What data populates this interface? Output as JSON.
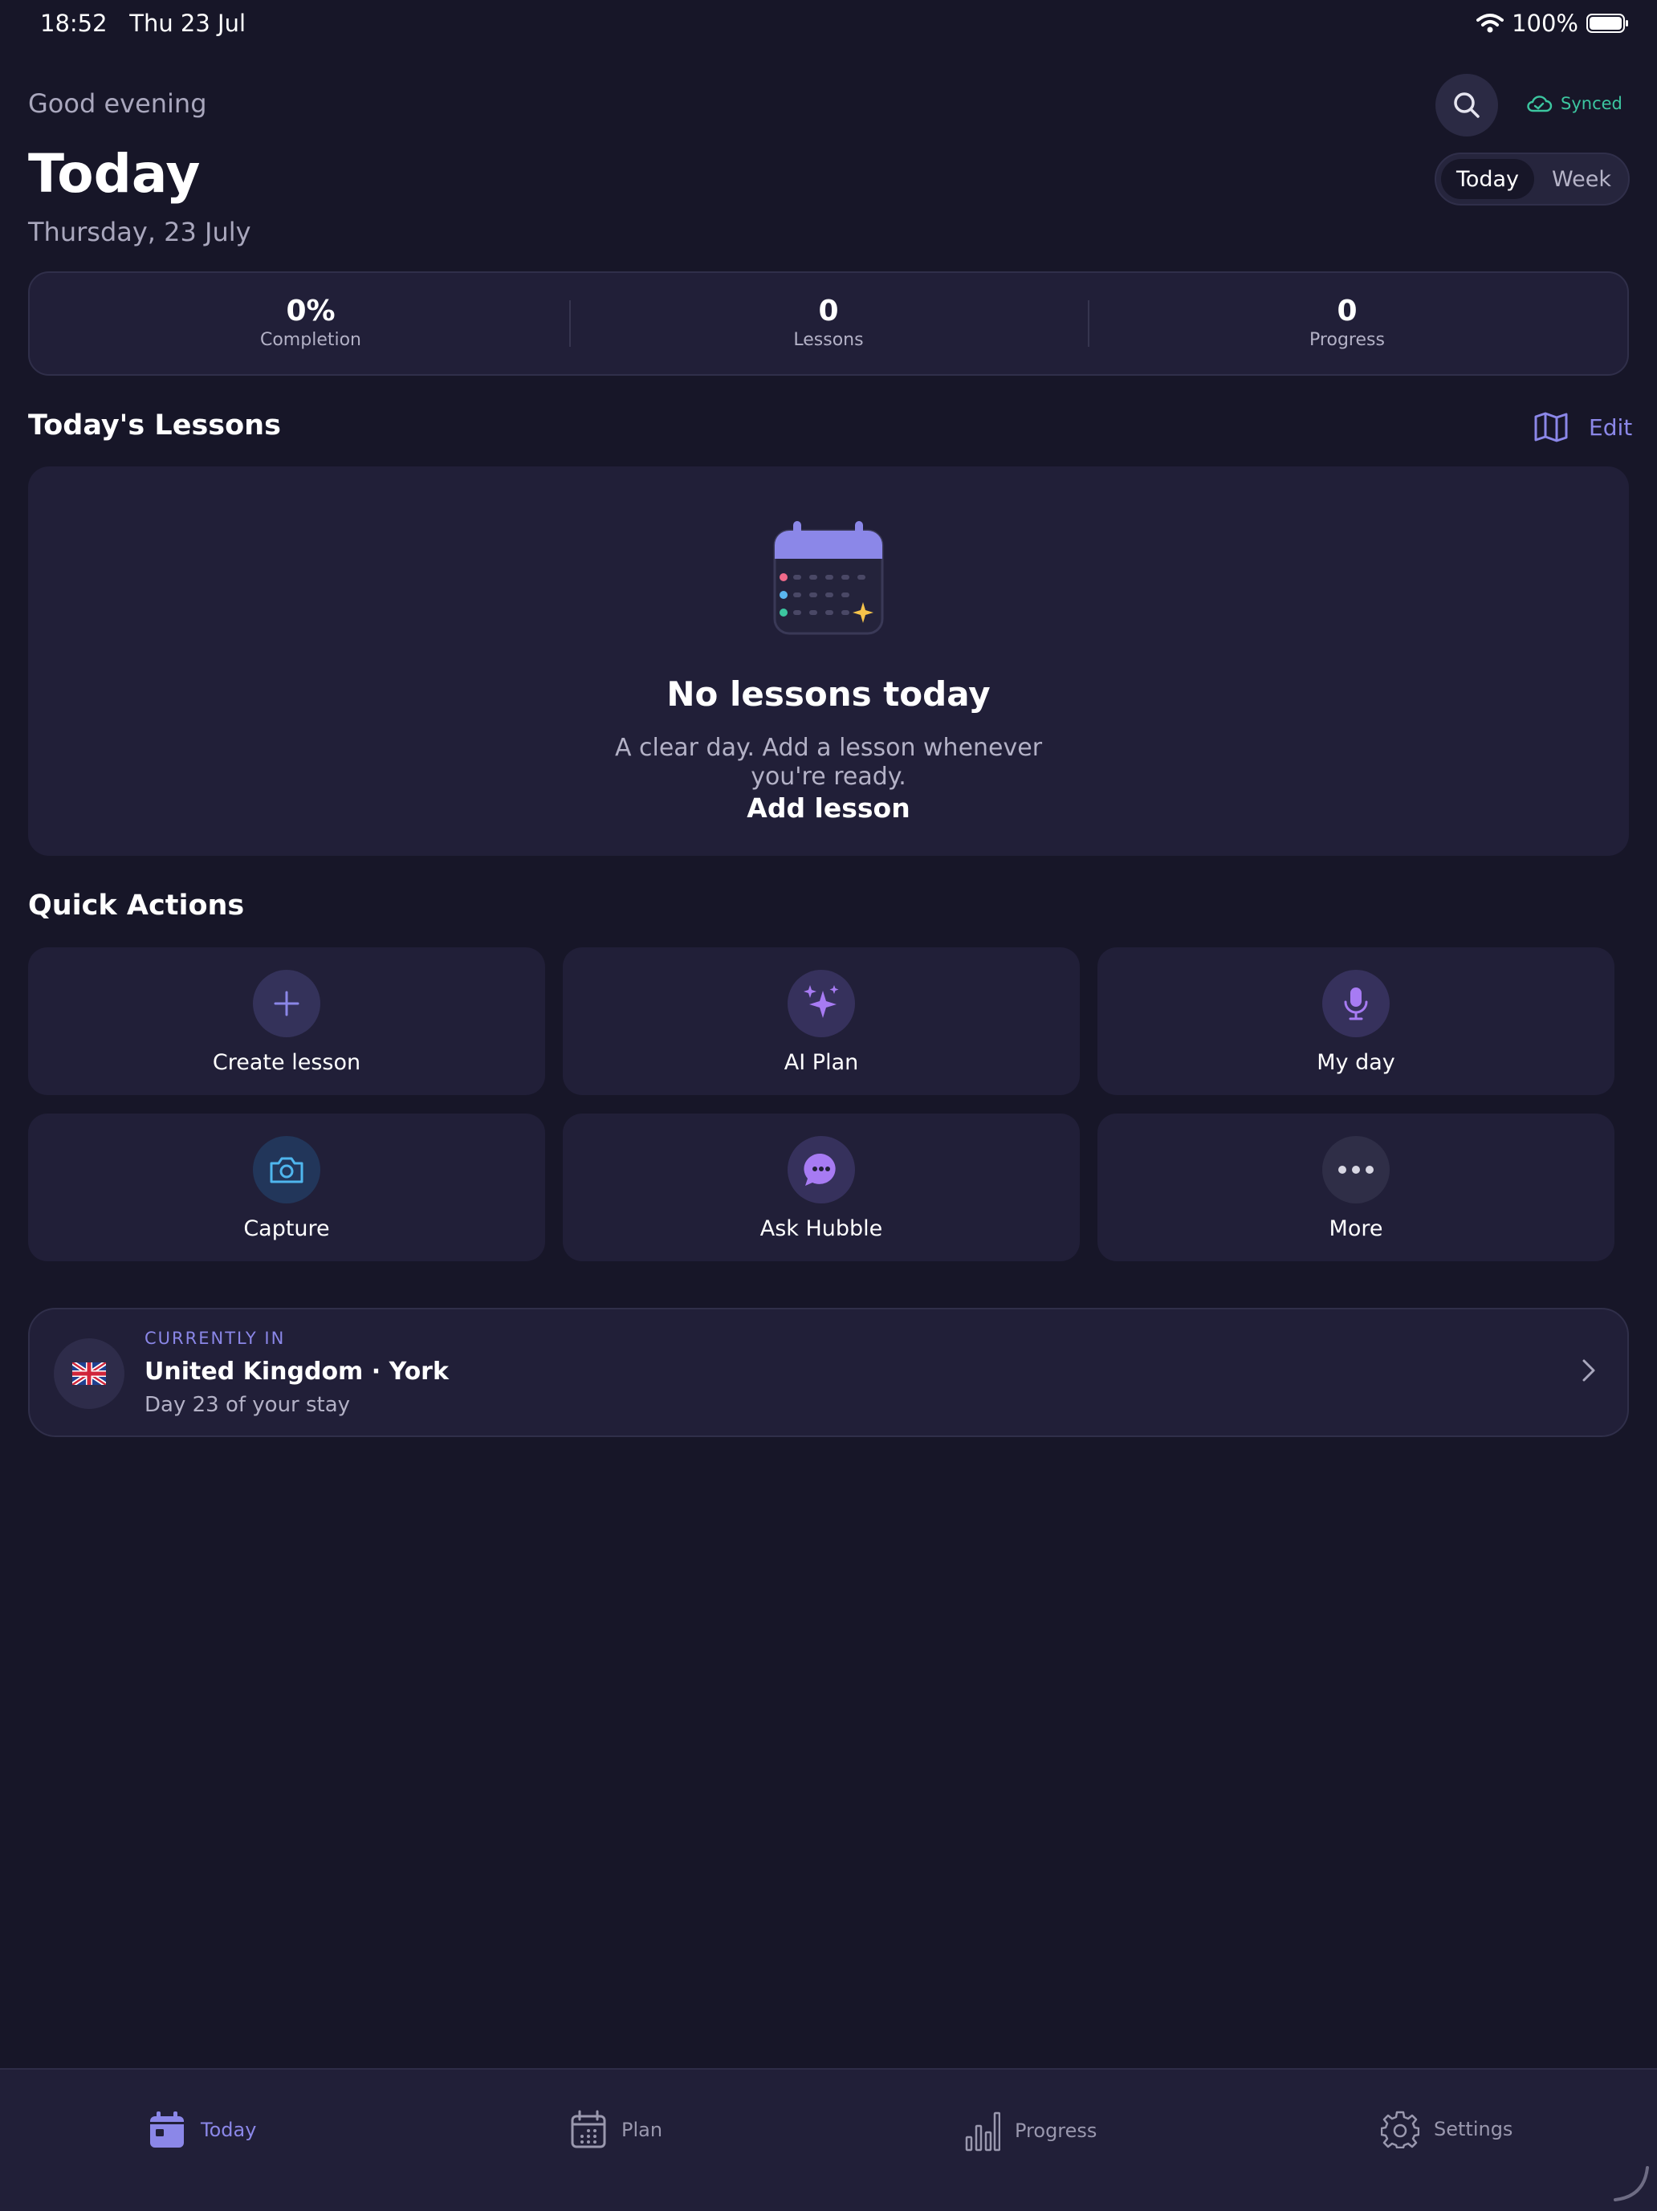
{
  "status_bar": {
    "time": "18:52",
    "date": "Thu 23 Jul",
    "battery": "100%"
  },
  "header": {
    "greeting": "Good evening",
    "title": "Today",
    "date": "Thursday, 23 July",
    "sync_status": "Synced",
    "segments": [
      "Today",
      "Week"
    ],
    "selected_segment": "Today"
  },
  "stats": [
    {
      "value": "0%",
      "label": "Completion"
    },
    {
      "value": "0",
      "label": "Lessons"
    },
    {
      "value": "0",
      "label": "Progress"
    }
  ],
  "lessons": {
    "title": "Today's Lessons",
    "edit_label": "Edit",
    "empty_title": "No lessons today",
    "empty_subtitle": "A clear day. Add a lesson whenever you're ready.",
    "add_label": "Add lesson"
  },
  "quick_actions": {
    "title": "Quick Actions",
    "items": [
      {
        "label": "Create lesson",
        "icon": "plus-icon"
      },
      {
        "label": "AI Plan",
        "icon": "sparkles-icon"
      },
      {
        "label": "My day",
        "icon": "microphone-icon"
      },
      {
        "label": "Capture",
        "icon": "camera-icon"
      },
      {
        "label": "Ask Hubble",
        "icon": "chat-bubble-icon"
      },
      {
        "label": "More",
        "icon": "more-icon"
      }
    ]
  },
  "location": {
    "eyebrow": "CURRENTLY IN",
    "title": "United Kingdom · York",
    "subtitle": "Day 23 of your stay"
  },
  "tabs": [
    {
      "label": "Today",
      "icon": "calendar-icon",
      "active": true
    },
    {
      "label": "Plan",
      "icon": "calendar-grid-icon",
      "active": false
    },
    {
      "label": "Progress",
      "icon": "bar-chart-icon",
      "active": false
    },
    {
      "label": "Settings",
      "icon": "gear-icon",
      "active": false
    }
  ],
  "colors": {
    "background": "#171628",
    "card": "#211f38",
    "accent": "#8b87e8",
    "synced": "#3cc6a0"
  }
}
